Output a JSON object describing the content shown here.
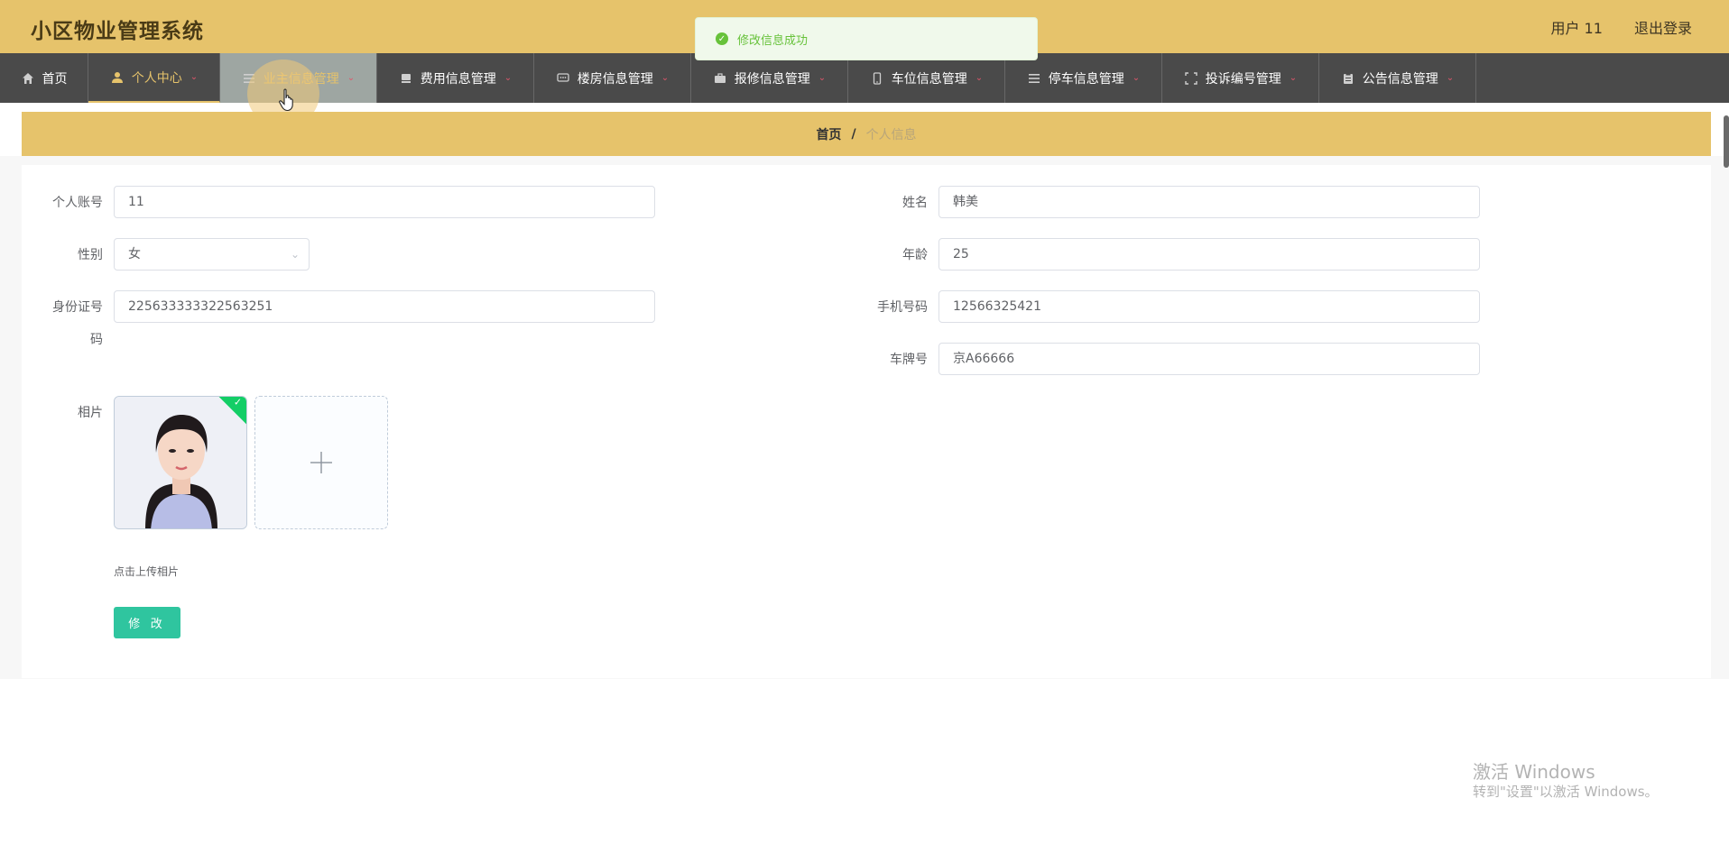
{
  "header": {
    "brand": "小区物业管理系统",
    "user": "用户 11",
    "logout": "退出登录"
  },
  "toast": {
    "message": "修改信息成功"
  },
  "nav": {
    "items": [
      {
        "label": "首页",
        "icon": "home-icon"
      },
      {
        "label": "个人中心",
        "icon": "user-icon"
      },
      {
        "label": "业主信息管理",
        "icon": "list-icon"
      },
      {
        "label": "费用信息管理",
        "icon": "bookmark-icon"
      },
      {
        "label": "楼房信息管理",
        "icon": "chat-icon"
      },
      {
        "label": "报修信息管理",
        "icon": "briefcase-icon"
      },
      {
        "label": "车位信息管理",
        "icon": "phone-icon"
      },
      {
        "label": "停车信息管理",
        "icon": "list-icon"
      },
      {
        "label": "投诉编号管理",
        "icon": "frame-icon"
      },
      {
        "label": "公告信息管理",
        "icon": "clipboard-icon"
      }
    ]
  },
  "breadcrumb": {
    "home": "首页",
    "separator": "/",
    "current": "个人信息"
  },
  "form": {
    "account_label": "个人账号",
    "account_value": "11",
    "name_label": "姓名",
    "name_value": "韩美",
    "gender_label": "性别",
    "gender_value": "女",
    "age_label": "年龄",
    "age_value": "25",
    "idcard_label_line1": "身份证号",
    "idcard_label_line2": "码",
    "idcard_value": "225633333322563251",
    "phone_label": "手机号码",
    "phone_value": "12566325421",
    "plate_label": "车牌号",
    "plate_value": "京A66666",
    "photo_label": "相片",
    "upload_tip": "点击上传相片",
    "submit_label": "修 改"
  },
  "watermark": {
    "line1": "激活 Windows",
    "line2": "转到\"设置\"以激活 Windows。"
  },
  "colors": {
    "brand": "#e6c36b",
    "nav_bg": "#4a4a4a",
    "submit": "#2fc59f",
    "success": "#67c23a"
  }
}
